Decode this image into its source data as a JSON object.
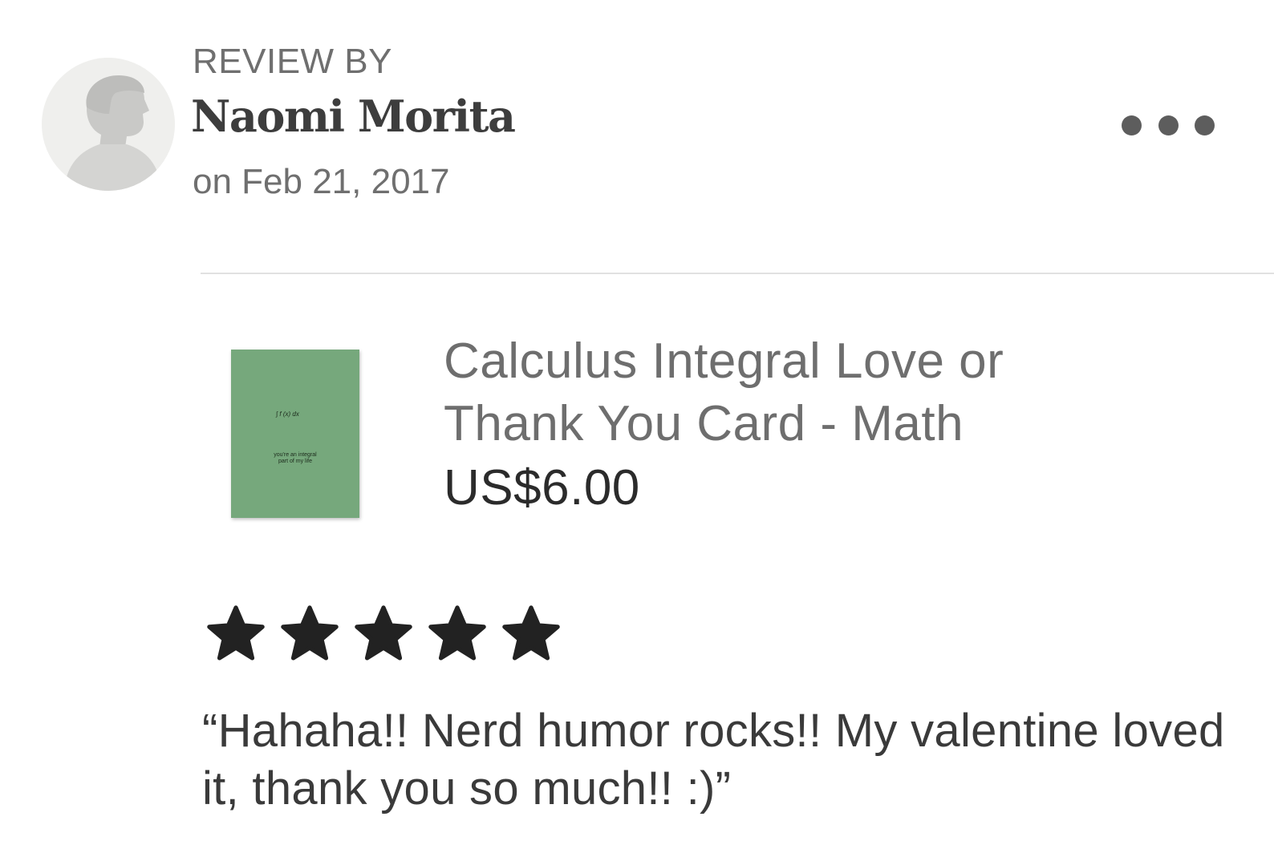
{
  "review": {
    "label": "REVIEW BY",
    "reviewer_name": "Naomi Morita",
    "date": "on Feb 21, 2017",
    "more_icon": "more-horizontal-icon",
    "rating": 5,
    "rating_max": 5,
    "text": "“Hahaha!! Nerd humor rocks!! My valentine loved it, thank you so much!! :)”"
  },
  "product": {
    "title_line1": "Calculus Integral Love or",
    "title_line2": "Thank You Card - Math",
    "price": "US$6.00",
    "card": {
      "formula": "∫ f (x) dx",
      "text_line1": "you're an integral",
      "text_line2": "part of my life"
    }
  },
  "colors": {
    "card_green": "#76a87c",
    "star": "#222222",
    "avatar_bg": "#efefed"
  }
}
